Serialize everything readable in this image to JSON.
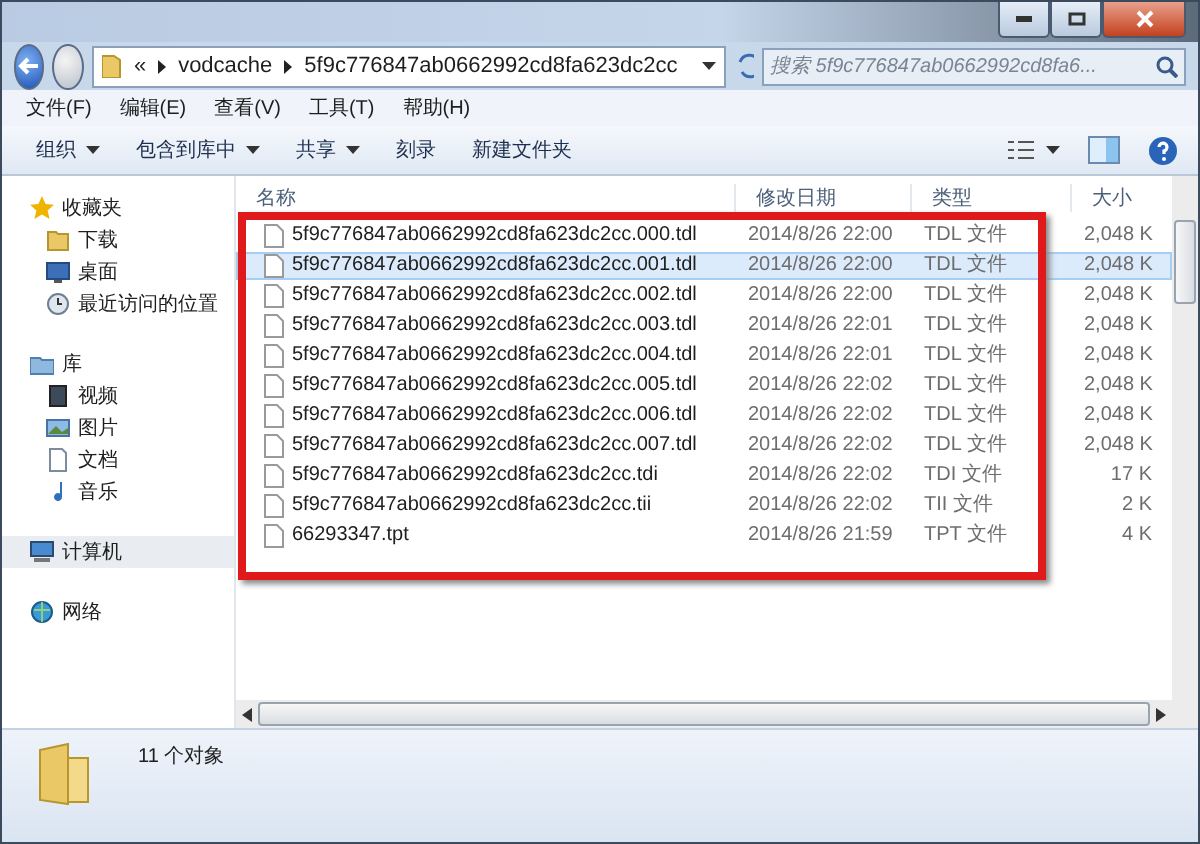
{
  "address": {
    "overflow": "«",
    "crumbs": [
      "vodcache",
      "5f9c776847ab0662992cd8fa623dc2cc"
    ]
  },
  "search": {
    "placeholder": "搜索 5f9c776847ab0662992cd8fa6..."
  },
  "menu": [
    "文件(F)",
    "编辑(E)",
    "查看(V)",
    "工具(T)",
    "帮助(H)"
  ],
  "toolbar": [
    {
      "label": "组织",
      "dropdown": true
    },
    {
      "label": "包含到库中",
      "dropdown": true
    },
    {
      "label": "共享",
      "dropdown": true
    },
    {
      "label": "刻录",
      "dropdown": false
    },
    {
      "label": "新建文件夹",
      "dropdown": false
    }
  ],
  "sidebar": [
    {
      "label": "收藏夹",
      "kind": "star",
      "selected": false,
      "children": [
        {
          "label": "下载",
          "kind": "download",
          "selected": false
        },
        {
          "label": "桌面",
          "kind": "desktop",
          "selected": false
        },
        {
          "label": "最近访问的位置",
          "kind": "recent",
          "selected": false
        }
      ]
    },
    {
      "label": "库",
      "kind": "library",
      "selected": false,
      "children": [
        {
          "label": "视频",
          "kind": "video",
          "selected": false
        },
        {
          "label": "图片",
          "kind": "picture",
          "selected": false
        },
        {
          "label": "文档",
          "kind": "document",
          "selected": false
        },
        {
          "label": "音乐",
          "kind": "music",
          "selected": false
        }
      ]
    },
    {
      "label": "计算机",
      "kind": "computer",
      "selected": true
    },
    {
      "label": "网络",
      "kind": "network",
      "selected": false
    }
  ],
  "table": {
    "columns": [
      "名称",
      "修改日期",
      "类型",
      "大小"
    ],
    "rows": [
      {
        "name": "5f9c776847ab0662992cd8fa623dc2cc.000.tdl",
        "date": "2014/8/26 22:00",
        "type": "TDL 文件",
        "size": "2,048 K",
        "selected": false
      },
      {
        "name": "5f9c776847ab0662992cd8fa623dc2cc.001.tdl",
        "date": "2014/8/26 22:00",
        "type": "TDL 文件",
        "size": "2,048 K",
        "selected": true
      },
      {
        "name": "5f9c776847ab0662992cd8fa623dc2cc.002.tdl",
        "date": "2014/8/26 22:00",
        "type": "TDL 文件",
        "size": "2,048 K",
        "selected": false
      },
      {
        "name": "5f9c776847ab0662992cd8fa623dc2cc.003.tdl",
        "date": "2014/8/26 22:01",
        "type": "TDL 文件",
        "size": "2,048 K",
        "selected": false
      },
      {
        "name": "5f9c776847ab0662992cd8fa623dc2cc.004.tdl",
        "date": "2014/8/26 22:01",
        "type": "TDL 文件",
        "size": "2,048 K",
        "selected": false
      },
      {
        "name": "5f9c776847ab0662992cd8fa623dc2cc.005.tdl",
        "date": "2014/8/26 22:02",
        "type": "TDL 文件",
        "size": "2,048 K",
        "selected": false
      },
      {
        "name": "5f9c776847ab0662992cd8fa623dc2cc.006.tdl",
        "date": "2014/8/26 22:02",
        "type": "TDL 文件",
        "size": "2,048 K",
        "selected": false
      },
      {
        "name": "5f9c776847ab0662992cd8fa623dc2cc.007.tdl",
        "date": "2014/8/26 22:02",
        "type": "TDL 文件",
        "size": "2,048 K",
        "selected": false
      },
      {
        "name": "5f9c776847ab0662992cd8fa623dc2cc.tdi",
        "date": "2014/8/26 22:02",
        "type": "TDI 文件",
        "size": "17 K",
        "selected": false
      },
      {
        "name": "5f9c776847ab0662992cd8fa623dc2cc.tii",
        "date": "2014/8/26 22:02",
        "type": "TII 文件",
        "size": "2 K",
        "selected": false
      },
      {
        "name": "66293347.tpt",
        "date": "2014/8/26 21:59",
        "type": "TPT 文件",
        "size": "4 K",
        "selected": false
      }
    ]
  },
  "status_bar": {
    "count": "11 个对象"
  }
}
